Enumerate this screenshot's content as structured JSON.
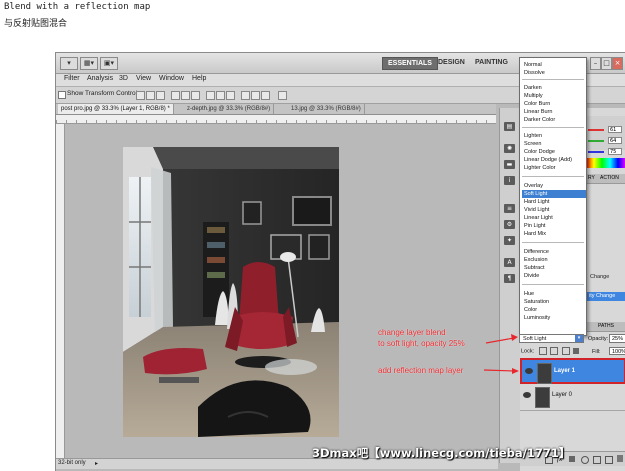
{
  "caption": {
    "english": "Blend with a reflection map",
    "chinese": "与反射贴图混合"
  },
  "app": {
    "workspaces": [
      "ESSENTIALS",
      "DESIGN",
      "PAINTING"
    ],
    "active_workspace": "ESSENTIALS"
  },
  "menu": [
    "Filter",
    "Analysis",
    "3D",
    "View",
    "Window",
    "Help"
  ],
  "options_bar": {
    "show_transform_controls": "Show Transform Controls"
  },
  "document_tabs": [
    "post pro.jpg @ 33.3% (Layer 1, RGB/8) *",
    "z-depth.jpg @ 33.3% (RGB/8#)",
    "13.jpg @ 33.3% (RGB/8#)"
  ],
  "blend_modes": {
    "groups": [
      [
        "Normal",
        "Dissolve"
      ],
      [
        "Darken",
        "Multiply",
        "Color Burn",
        "Linear Burn",
        "Darker Color"
      ],
      [
        "Lighten",
        "Screen",
        "Color Dodge",
        "Linear Dodge (Add)",
        "Lighter Color"
      ],
      [
        "Overlay",
        "Soft Light",
        "Hard Light",
        "Vivid Light",
        "Linear Light",
        "Pin Light",
        "Hard Mix"
      ],
      [
        "Difference",
        "Exclusion",
        "Subtract",
        "Divide"
      ],
      [
        "Hue",
        "Saturation",
        "Color",
        "Luminosity"
      ]
    ],
    "selected": "Soft Light"
  },
  "color_panel": {
    "values": [
      "61",
      "64",
      "75"
    ]
  },
  "panel_tabs": {
    "tab1": "RY",
    "tab2": "ACTION"
  },
  "adjustments": {
    "item1": "Change",
    "item2": "ity Change"
  },
  "layers_panel": {
    "header": "PATHS",
    "blend_mode": "Soft Light",
    "opacity_label": "Opacity:",
    "opacity_value": "25%",
    "lock_label": "Lock:",
    "fill_label": "Fill:",
    "fill_value": "100%",
    "layers": [
      {
        "name": "Layer 1",
        "active": true
      },
      {
        "name": "Layer 0",
        "active": false
      }
    ]
  },
  "annotations": {
    "blend_line1": "change layer blend",
    "blend_line2": "to soft light, opacity 25%",
    "reflection": "add reflection map layer"
  },
  "status_bar": {
    "text": "32-bit only"
  },
  "watermark": "3Dmax吧【www.linecg.com/tieba/1771】",
  "colors": {
    "highlight": "#3d7fd1",
    "annotation": "#e8262b",
    "canvas_bg": "#b9b9b9"
  }
}
